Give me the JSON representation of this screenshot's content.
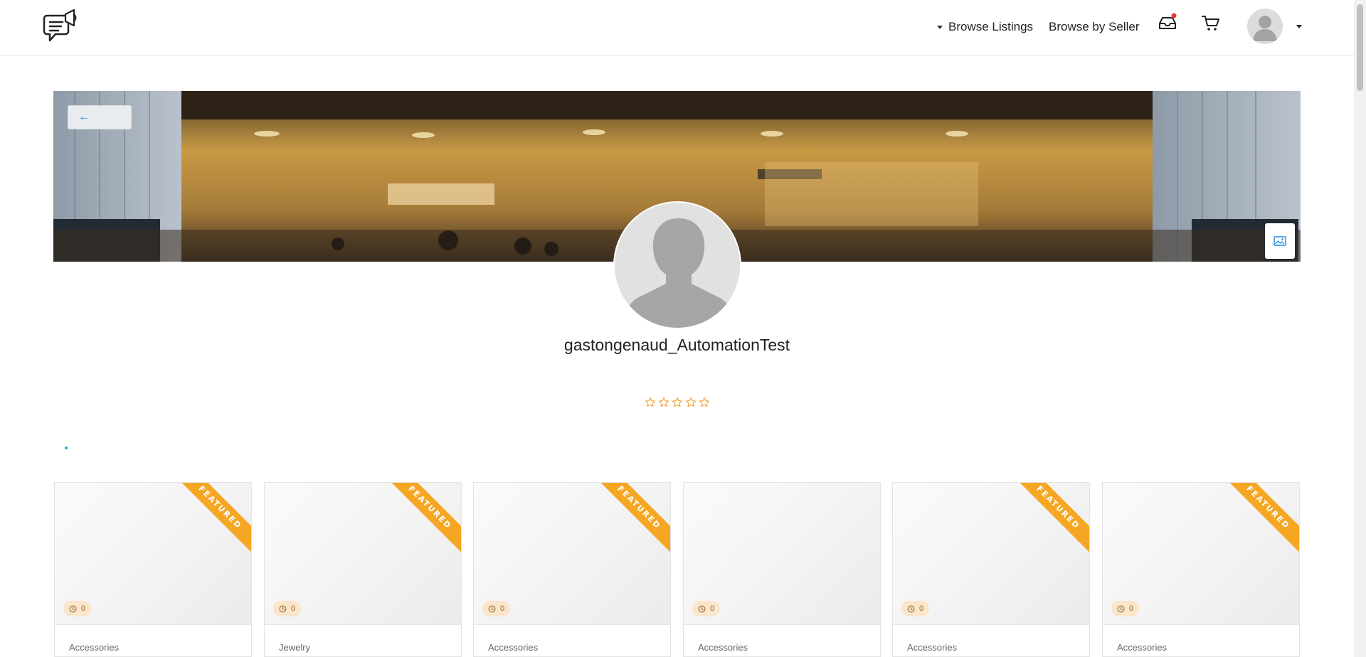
{
  "header": {
    "browse_listings": "Browse Listings",
    "browse_by_seller": "Browse by Seller"
  },
  "banner": {
    "back_label": "←"
  },
  "profile": {
    "username": "gastongenaud_AutomationTest",
    "rating_stars": 5,
    "rating_value": 0
  },
  "colors": {
    "featured_ribbon": "#f5a623",
    "timer_badge": "#fbe6c9",
    "accent_link": "#1e88e5",
    "star_outline": "#f0a030"
  },
  "cards": [
    {
      "category": "Accessories",
      "timer": "0",
      "featured": true,
      "ribbon": "FEATURED"
    },
    {
      "category": "Jewelry",
      "timer": "0",
      "featured": true,
      "ribbon": "FEATURED"
    },
    {
      "category": "Accessories",
      "timer": "0",
      "featured": true,
      "ribbon": "FEATURED"
    },
    {
      "category": "Accessories",
      "timer": "0",
      "featured": false,
      "ribbon": ""
    },
    {
      "category": "Accessories",
      "timer": "0",
      "featured": true,
      "ribbon": "FEATURED"
    },
    {
      "category": "Accessories",
      "timer": "0",
      "featured": true,
      "ribbon": "FEATURED"
    }
  ]
}
